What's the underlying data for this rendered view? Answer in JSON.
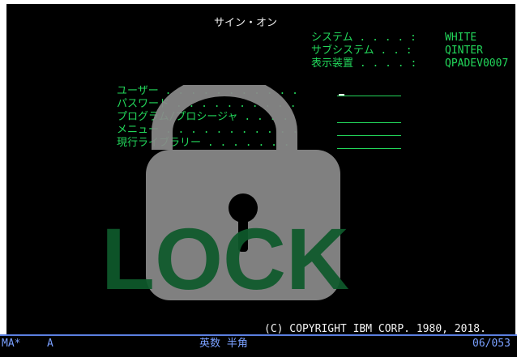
{
  "screen": {
    "title": "サイン・オン",
    "system_info": [
      {
        "label": "システム . . . . :",
        "value": "WHITE"
      },
      {
        "label": "サブシステム . . :",
        "value": "QINTER"
      },
      {
        "label": "表示装置 . . . . :",
        "value": "QPADEV0007"
      }
    ],
    "prompts": {
      "user": "ユーザー . . . . . . . . . . .",
      "password": "パスワード . . . . . . . . . .",
      "program": "プログラム/プロシージャ . . . .",
      "menu": "メニュー . . . . . . . . . . .",
      "library": "現行ライブラリー . . . . . . ."
    },
    "copyright": "(C) COPYRIGHT IBM CORP. 1980, 2018.",
    "overlay": {
      "icon": "padlock",
      "text": "LOCK",
      "lock_color": "#8a8a8a",
      "text_color": "#0e5a2c"
    }
  },
  "status": {
    "session": "MA*",
    "mode": "A",
    "input_mode": "英数 半角",
    "cursor_pos": "06/053"
  },
  "colors": {
    "background": "#000000",
    "text_green": "#22d65a",
    "text_white": "#f2f2f2",
    "status_blue": "#7aa0ff"
  }
}
